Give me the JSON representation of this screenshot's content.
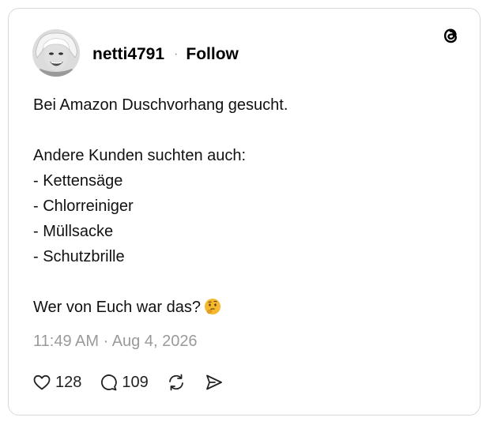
{
  "post": {
    "username": "netti4791",
    "separator": "·",
    "follow_label": "Follow",
    "lines": [
      "Bei Amazon Duschvorhang gesucht.",
      "",
      "Andere Kunden suchten auch:",
      "- Kettensäge",
      "- Chlorreiniger",
      "- Müllsacke",
      "- Schutzbrille",
      "",
      "Wer von Euch war das?"
    ],
    "trailing_emoji": "thinking-face",
    "timestamp": "11:49 AM · Aug 4, 2026",
    "likes": "128",
    "replies": "109"
  },
  "icons": {
    "brand": "threads-logo",
    "like": "heart-icon",
    "reply": "comment-icon",
    "repost": "repost-icon",
    "share": "send-icon"
  },
  "colors": {
    "text": "#111111",
    "muted": "#9a9a9a",
    "border": "#d9d9d9",
    "emoji": "#f5b82e"
  }
}
